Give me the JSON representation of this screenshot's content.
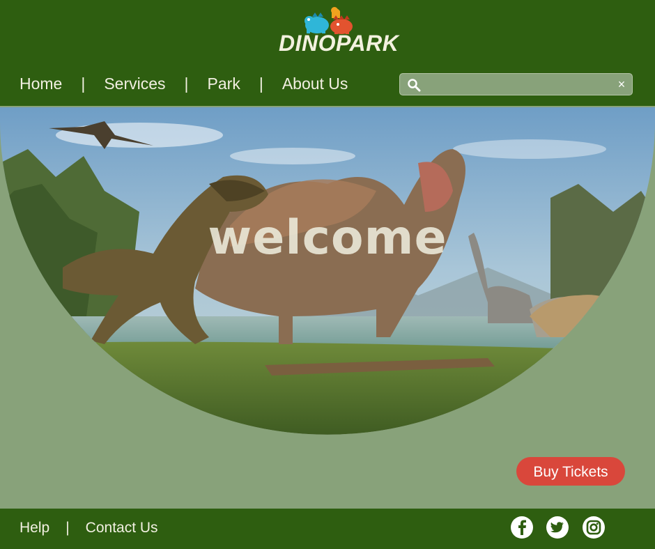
{
  "header": {
    "logo_text": "DINOPARK",
    "nav": [
      {
        "label": "Home"
      },
      {
        "label": "Services"
      },
      {
        "label": "Park"
      },
      {
        "label": "About Us"
      }
    ],
    "separator": "|",
    "search": {
      "placeholder": "",
      "value": "",
      "clear_glyph": "×"
    }
  },
  "hero": {
    "title": "welcome"
  },
  "cta": {
    "label": "Buy Tickets"
  },
  "footer": {
    "links": [
      {
        "label": "Help"
      },
      {
        "label": "Contact Us"
      }
    ],
    "separator": "|",
    "social": [
      "facebook-icon",
      "twitter-icon",
      "instagram-icon"
    ]
  },
  "colors": {
    "header_bg": "#2e5e10",
    "page_bg": "#88a27a",
    "cta_bg": "#d9473b",
    "text_light": "#f2f0e2"
  }
}
